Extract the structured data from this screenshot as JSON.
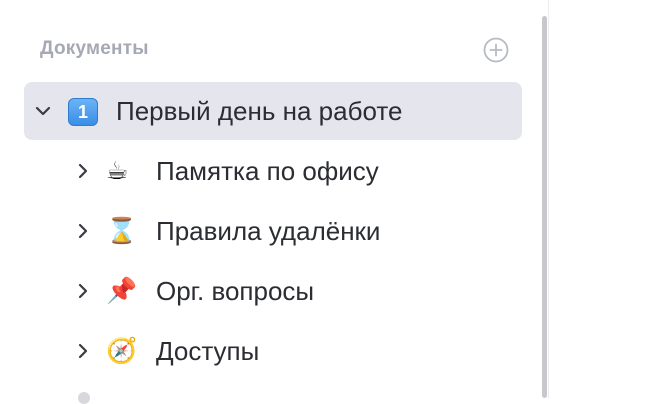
{
  "sidebar": {
    "section_title": "Документы",
    "add_button_icon": "plus-circle-icon",
    "items": [
      {
        "label": "Первый день на работе",
        "emoji": "1️⃣",
        "expanded": true,
        "selected": true,
        "icon": "chevron-down-icon"
      },
      {
        "label": "Памятка по офису",
        "emoji": "☕",
        "expanded": false,
        "selected": false,
        "icon": "chevron-right-icon"
      },
      {
        "label": "Правила удалёнки",
        "emoji": "⌛",
        "expanded": false,
        "selected": false,
        "icon": "chevron-right-icon"
      },
      {
        "label": "Орг. вопросы",
        "emoji": "📌",
        "expanded": false,
        "selected": false,
        "icon": "chevron-right-icon"
      },
      {
        "label": "Доступы",
        "emoji": "🧭",
        "expanded": false,
        "selected": false,
        "icon": "chevron-right-icon"
      }
    ]
  },
  "colors": {
    "selected_background": "#e5e6ed",
    "section_title": "#a6a9b4",
    "text": "#2b2d33",
    "scrollbar": "#c7c7cc"
  }
}
